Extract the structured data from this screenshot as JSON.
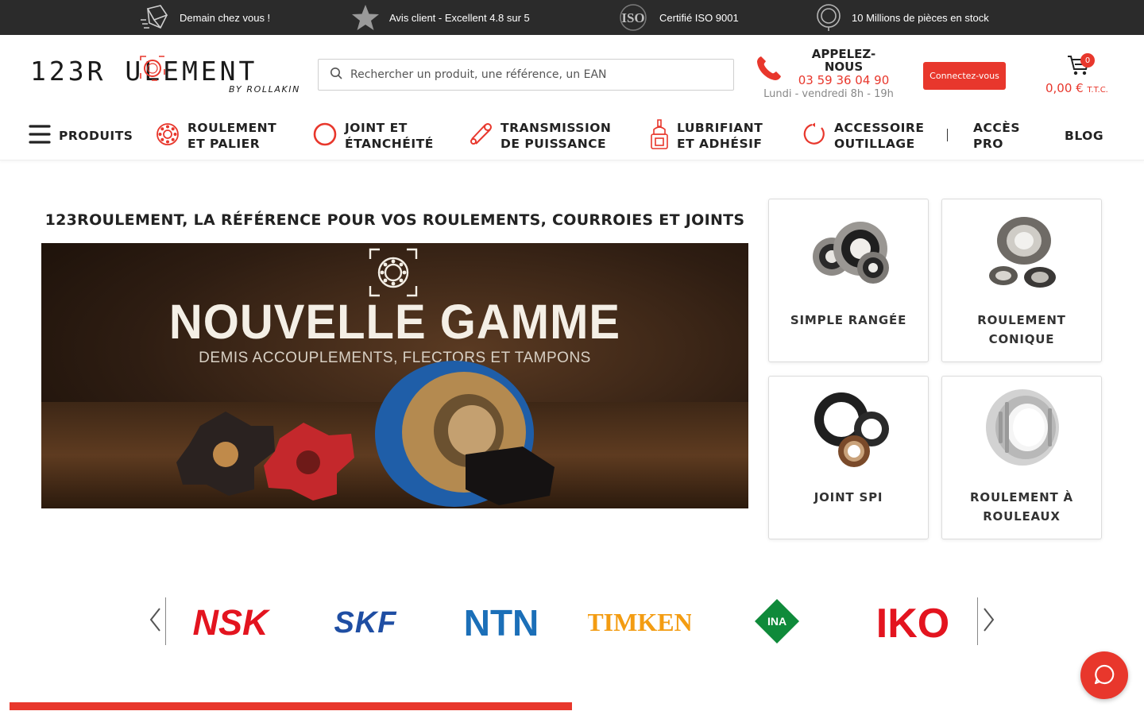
{
  "topbar": {
    "items": [
      {
        "icon": "delivery-box-icon",
        "text": "Demain chez vous !"
      },
      {
        "icon": "star-icon",
        "text": "Avis client - Excellent 4.8 sur 5"
      },
      {
        "icon": "iso-badge-icon",
        "badge": "ISO",
        "text": "Certifié ISO 9001"
      },
      {
        "icon": "bearing-parts-icon",
        "text": "10 Millions de pièces en stock"
      }
    ]
  },
  "header": {
    "logo_text": "123R ULEMENT",
    "logo_sub": "BY ROLLAKIN",
    "search_placeholder": "Rechercher un produit, une référence, un EAN",
    "phone_title": "APPELEZ-NOUS",
    "phone_number": "03 59 36 04 90",
    "phone_hours": "Lundi - vendredi 8h - 19h",
    "login_label": "Connectez-vous",
    "cart_count": "0",
    "cart_total": "0,00 €",
    "cart_ttc": "T.T.C."
  },
  "nav": {
    "products": "PRODUITS",
    "items": [
      {
        "line1": "ROULEMENT",
        "line2": "ET PALIER",
        "icon": "bearing-icon"
      },
      {
        "line1": "JOINT ET",
        "line2": "ÉTANCHÉITÉ",
        "icon": "seal-ring-icon"
      },
      {
        "line1": "TRANSMISSION",
        "line2": "DE PUISSANCE",
        "icon": "belt-icon"
      },
      {
        "line1": "LUBRIFIANT",
        "line2": "ET ADHÉSIF",
        "icon": "lubricant-bottle-icon"
      },
      {
        "line1": "ACCESSOIRE",
        "line2": "OUTILLAGE",
        "icon": "tool-icon"
      }
    ],
    "pro_line1": "ACCÈS",
    "pro_line2": "PRO",
    "blog": "BLOG"
  },
  "main": {
    "heading": "123ROULEMENT, LA RÉFÉRENCE POUR VOS ROULEMENTS, COURROIES ET JOINTS",
    "banner_title": "NOUVELLE GAMME",
    "banner_sub": "DEMIS ACCOUPLEMENTS, FLECTORS ET TAMPONS",
    "categories": [
      {
        "line1": "SIMPLE RANGÉE",
        "line2": "",
        "image": "ball-bearing-image"
      },
      {
        "line1": "ROULEMENT",
        "line2": "CONIQUE",
        "image": "tapered-bearing-image"
      },
      {
        "line1": "JOINT SPI",
        "line2": "",
        "image": "shaft-seal-image"
      },
      {
        "line1": "ROULEMENT À",
        "line2": "ROULEAUX",
        "image": "roller-bearing-image"
      }
    ]
  },
  "brands": {
    "items": [
      {
        "name": "NSK",
        "color": "#e3141f"
      },
      {
        "name": "SKF",
        "color": "#1f4ea3"
      },
      {
        "name": "NTN",
        "color": "#1b6fb8"
      },
      {
        "name": "TIMKEN",
        "color": "#f39c12"
      },
      {
        "name": "INA",
        "color": "#0f8a3a"
      },
      {
        "name": "IKO",
        "color": "#e3141f"
      }
    ]
  },
  "progress": {
    "value": 0.5
  },
  "colors": {
    "accent": "#e8372c",
    "topbar": "#2b2b2b"
  }
}
